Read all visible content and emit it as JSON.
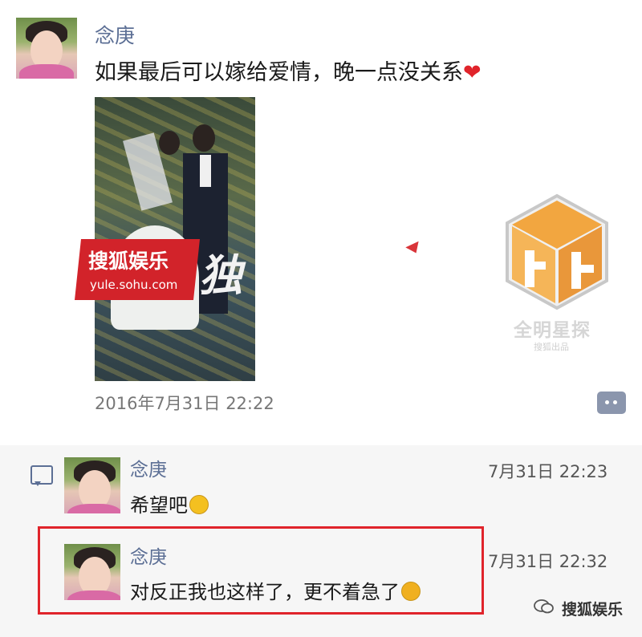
{
  "post": {
    "author": "念庚",
    "text": "如果最后可以嫁给爱情，晚一点没关系",
    "heart_icon": "❤",
    "photo": {
      "overlay_char": "独",
      "badge_title": "搜狐娱乐",
      "badge_url": "yule.sohu.com"
    },
    "timestamp": "2016年7月31日 22:22"
  },
  "watermark": {
    "label": "全明星探",
    "sub": "搜狐出品"
  },
  "comments": [
    {
      "author": "念庚",
      "text": "希望吧",
      "emoji": "smile-emoji",
      "time": "7月31日  22:23"
    },
    {
      "author": "念庚",
      "text": "对反正我也这样了，更不着急了",
      "emoji": "smirk-emoji",
      "time": "7月31日  22:32"
    }
  ],
  "footer": {
    "brand": "搜狐娱乐"
  },
  "colors": {
    "name": "#5c6f95",
    "highlight": "#e0242b",
    "sohu_red": "#d2232a"
  }
}
